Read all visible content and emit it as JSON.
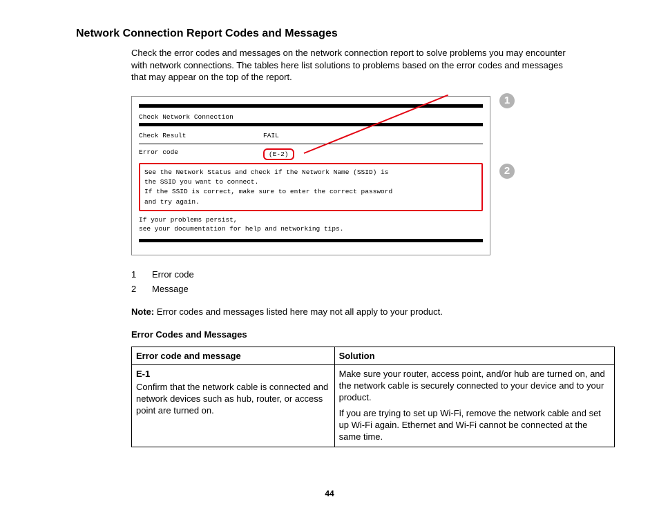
{
  "title": "Network Connection Report Codes and Messages",
  "intro": "Check the error codes and messages on the network connection report to solve problems you may encounter with network connections. The tables here list solutions to problems based on the error codes and messages that may appear on the top of the report.",
  "figure": {
    "heading": "Check Network Connection",
    "check_result_label": "Check Result",
    "check_result_value": "FAIL",
    "error_code_label": "Error code",
    "error_code_value": "(E-2)",
    "message_lines": [
      "See the Network Status and check if the Network Name (SSID) is",
      "the SSID you want to connect.",
      "If the SSID is correct, make sure to enter the correct password",
      "and try again."
    ],
    "persist_lines": [
      "If your problems persist,",
      "see your documentation for help and networking tips."
    ],
    "callouts": {
      "c1": "1",
      "c2": "2"
    }
  },
  "legend": [
    {
      "num": "1",
      "label": "Error code"
    },
    {
      "num": "2",
      "label": "Message"
    }
  ],
  "note_label": "Note:",
  "note_text": " Error codes and messages listed here may not all apply to your product.",
  "table_heading": "Error Codes and Messages",
  "table": {
    "head_code": "Error code and message",
    "head_solution": "Solution",
    "row1": {
      "code": "E-1",
      "code_desc": "Confirm that the network cable is connected and network devices such as hub, router, or access point are turned on.",
      "sol_p1": "Make sure your router, access point, and/or hub are turned on, and the network cable is securely connected to your device and to your product.",
      "sol_p2": "If you are trying to set up Wi-Fi, remove the network cable and set up Wi-Fi again. Ethernet and Wi-Fi cannot be connected at the same time."
    }
  },
  "page_number": "44"
}
